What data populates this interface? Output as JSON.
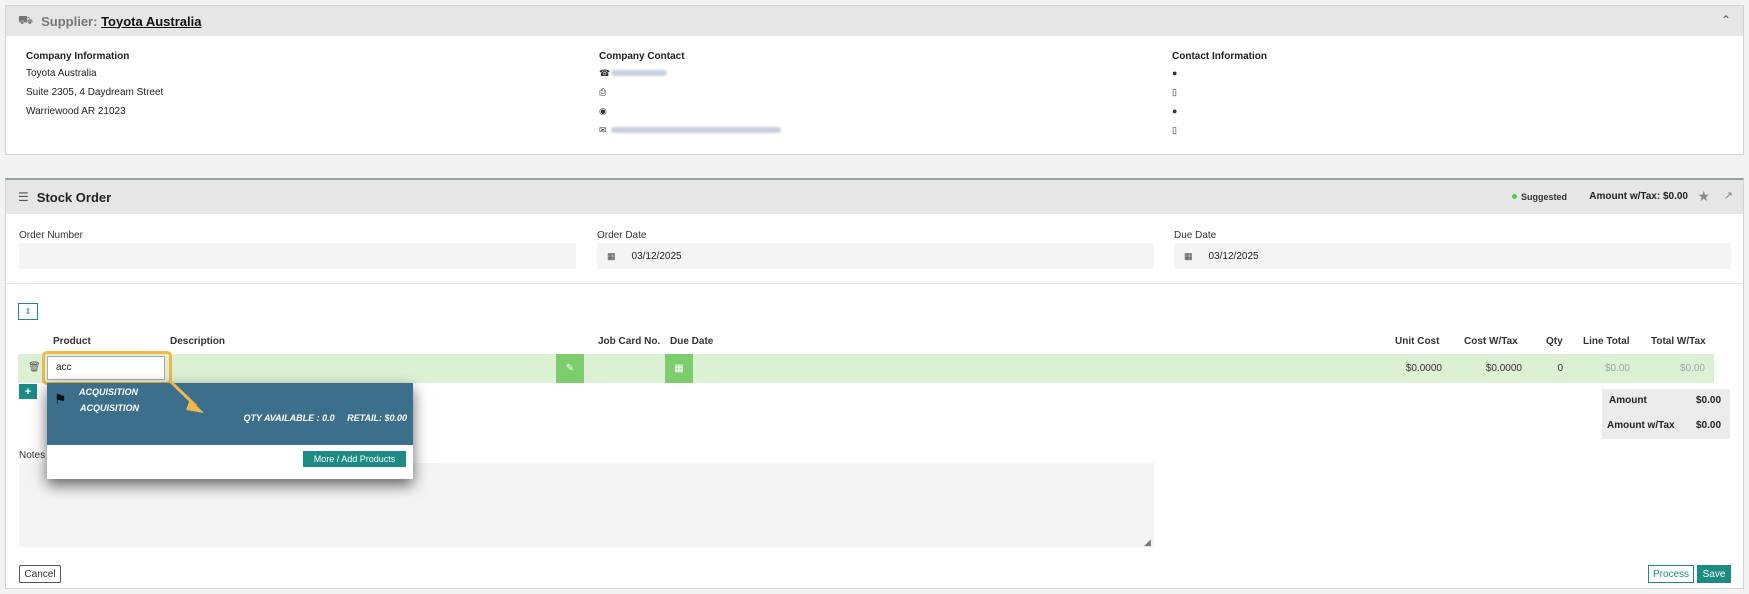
{
  "supplier": {
    "label": "Supplier:",
    "name": "Toyota Australia",
    "company_info": {
      "heading": "Company Information",
      "lines": [
        "Toyota Australia",
        "Suite 2305, 4 Daydream Street",
        "Warriewood AR 21023"
      ]
    },
    "company_contact": {
      "heading": "Company Contact"
    },
    "contact_info": {
      "heading": "Contact Information"
    }
  },
  "stock_order": {
    "title": "Stock Order",
    "status": "Suggested",
    "amount_label": "Amount w/Tax: $0.00",
    "order_number_label": "Order Number",
    "order_number_value": "",
    "order_date_label": "Order Date",
    "order_date_value": "03/12/2025",
    "due_date_label": "Due Date",
    "due_date_value": "03/12/2025"
  },
  "table": {
    "headers": {
      "product": "Product",
      "description": "Description",
      "job_card": "Job Card No.",
      "due_date": "Due Date",
      "unit_cost": "Unit Cost",
      "cost_wtax": "Cost W/Tax",
      "qty": "Qty",
      "line_total": "Line Total",
      "total_wtax": "Total W/Tax"
    },
    "row": {
      "product_value": "acc",
      "unit_cost": "$0.0000",
      "cost_wtax": "$0.0000",
      "qty": "0",
      "line_total": "$0.00",
      "total_wtax": "$0.00"
    }
  },
  "dropdown": {
    "item_title": "ACQUISITION",
    "item_sub": "ACQUISITION",
    "item_meta": "QTY AVAILABLE : 0.0     RETAIL: $0.00",
    "more_button": "More / Add Products"
  },
  "totals": {
    "amount_label": "Amount",
    "amount_value": "$0.00",
    "amount_wtax_label": "Amount w/Tax",
    "amount_wtax_value": "$0.00"
  },
  "notes_label": "Notes",
  "buttons": {
    "cancel": "Cancel",
    "process": "Process",
    "save": "Save"
  },
  "colors": {
    "accent": "#1e8a84",
    "row_green": "#dcf0d4",
    "dropdown_bg": "#3c6f8c",
    "highlight": "#f0b64a"
  }
}
